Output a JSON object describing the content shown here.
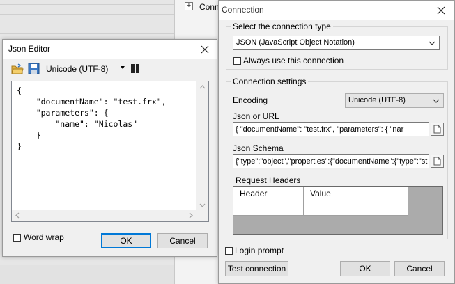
{
  "background": {
    "tree_item_label": "Conne"
  },
  "json_editor": {
    "title": "Json Editor",
    "encoding": "Unicode (UTF-8)",
    "content": "{\n    \"documentName\": \"test.frx\",\n    \"parameters\": {\n        \"name\": \"Nicolas\"\n    }\n}",
    "word_wrap_label": "Word wrap",
    "word_wrap_checked": false,
    "ok_label": "OK",
    "cancel_label": "Cancel"
  },
  "connection": {
    "title": "Connection",
    "type_group_title": "Select the connection type",
    "connection_type": "JSON (JavaScript Object Notation)",
    "always_use_label": "Always use this connection",
    "always_use_checked": false,
    "settings_group_title": "Connection settings",
    "encoding_label": "Encoding",
    "encoding_value": "Unicode (UTF-8)",
    "json_or_url_label": "Json or URL",
    "json_or_url_value": "{    \"documentName\": \"test.frx\",    \"parameters\": {        \"nar",
    "json_schema_label": "Json Schema",
    "json_schema_value": "{\"type\":\"object\",\"properties\":{\"documentName\":{\"type\":\"st",
    "request_headers_label": "Request Headers",
    "headers_columns": [
      "Header",
      "Value"
    ],
    "login_prompt_label": "Login prompt",
    "login_prompt_checked": false,
    "test_connection_label": "Test connection",
    "ok_label": "OK",
    "cancel_label": "Cancel"
  },
  "icons": [
    "open-folder-icon",
    "save-icon",
    "dropdown-arrow-icon",
    "barcode-icon",
    "close-icon",
    "document-icon",
    "chevron-down-icon",
    "scroll-arrow-icon",
    "plus-icon"
  ],
  "colors": {
    "accent": "#0078d7",
    "window_bg": "#f0f0f0",
    "grid_bg": "#ababab"
  }
}
